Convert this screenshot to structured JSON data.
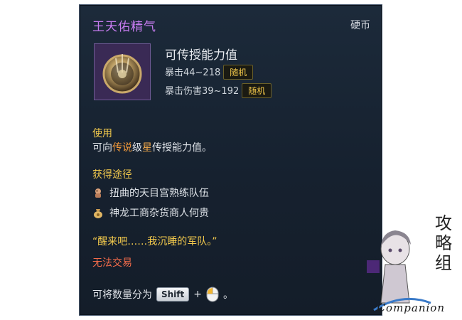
{
  "tooltip": {
    "title": "王天佑精气",
    "currency_label": "硬币",
    "stat_title": "可传授能力值",
    "stats": [
      {
        "label": "暴击44~218",
        "badge": "随机"
      },
      {
        "label": "暴击伤害39~192",
        "badge": "随机"
      }
    ],
    "usage": {
      "label": "使用",
      "text_prefix": "可向",
      "text_legend": "传说",
      "text_mid": "级",
      "text_star": "星",
      "text_suffix": "传授能力值。"
    },
    "obtain": {
      "label": "获得途径",
      "sources": [
        {
          "icon": "monster-icon",
          "text": "扭曲的天目宫熟练队伍"
        },
        {
          "icon": "merchant-bag-icon",
          "text": "神龙工商杂货商人何贵"
        }
      ]
    },
    "quote": "“醒来吧……我沉睡的军队。”",
    "untradeable": "无法交易",
    "split": {
      "prefix": "可将数量分为",
      "key": "Shift",
      "plus": "+",
      "suffix": "。"
    }
  },
  "watermark": {
    "text": "Companion",
    "chars": [
      "攻",
      "略",
      "组"
    ]
  },
  "colors": {
    "title": "#c77cf0",
    "section": "#f2c94c",
    "badge": "#f0c64a",
    "untradeable": "#f26b4a",
    "legend": "#f29a3a"
  }
}
